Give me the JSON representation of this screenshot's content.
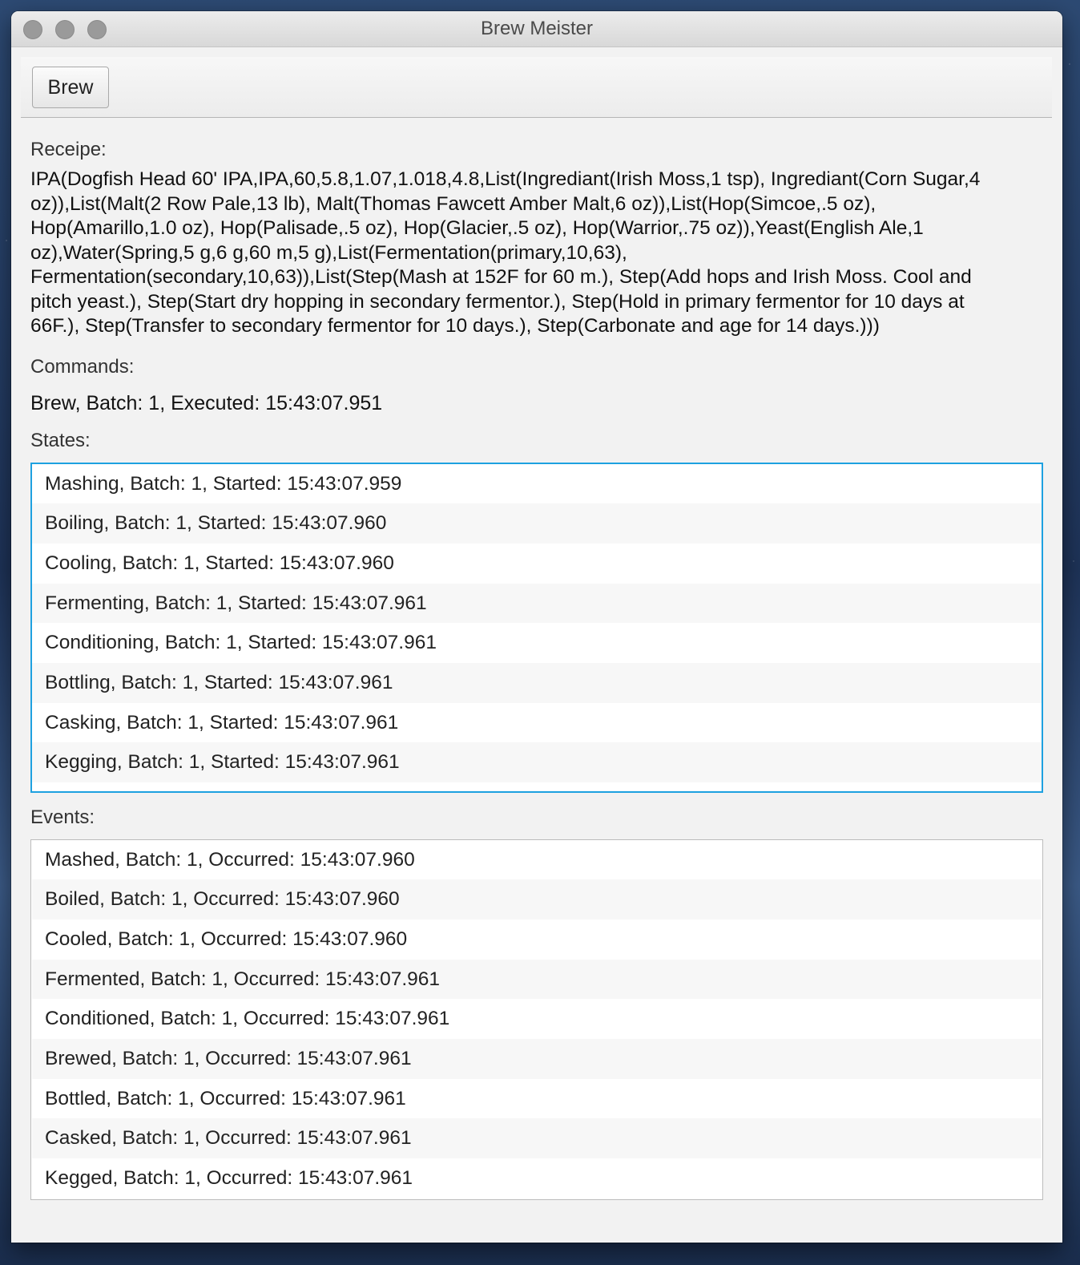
{
  "window": {
    "title": "Brew Meister"
  },
  "toolbar": {
    "brew_label": "Brew"
  },
  "recipe": {
    "label": "Receipe:",
    "text": "IPA(Dogfish Head 60' IPA,IPA,60,5.8,1.07,1.018,4.8,List(Ingrediant(Irish Moss,1 tsp), Ingrediant(Corn Sugar,4 oz)),List(Malt(2 Row Pale,13 lb), Malt(Thomas Fawcett Amber Malt,6 oz)),List(Hop(Simcoe,.5 oz), Hop(Amarillo,1.0 oz), Hop(Palisade,.5 oz), Hop(Glacier,.5 oz), Hop(Warrior,.75 oz)),Yeast(English Ale,1 oz),Water(Spring,5 g,6 g,60 m,5 g),List(Fermentation(primary,10,63), Fermentation(secondary,10,63)),List(Step(Mash at 152F for 60 m.), Step(Add hops and Irish Moss. Cool and pitch yeast.), Step(Start dry hopping in secondary fermentor.), Step(Hold in primary fermentor for 10 days at 66F.), Step(Transfer to secondary fermentor for 10 days.), Step(Carbonate and age for 14 days.)))"
  },
  "commands": {
    "label": "Commands:",
    "text": "Brew, Batch: 1, Executed: 15:43:07.951"
  },
  "states": {
    "label": "States:",
    "items": [
      "Mashing, Batch: 1, Started: 15:43:07.959",
      "Boiling, Batch: 1, Started: 15:43:07.960",
      "Cooling, Batch: 1, Started: 15:43:07.960",
      "Fermenting, Batch: 1, Started: 15:43:07.961",
      "Conditioning, Batch: 1, Started: 15:43:07.961",
      "Bottling, Batch: 1, Started: 15:43:07.961",
      "Casking, Batch: 1, Started: 15:43:07.961",
      "Kegging, Batch: 1, Started: 15:43:07.961"
    ]
  },
  "events": {
    "label": "Events:",
    "items": [
      "Mashed, Batch: 1, Occurred: 15:43:07.960",
      "Boiled, Batch: 1, Occurred: 15:43:07.960",
      "Cooled, Batch: 1, Occurred: 15:43:07.960",
      "Fermented, Batch: 1, Occurred: 15:43:07.961",
      "Conditioned, Batch: 1, Occurred: 15:43:07.961",
      "Brewed, Batch: 1, Occurred: 15:43:07.961",
      "Bottled, Batch: 1, Occurred: 15:43:07.961",
      "Casked, Batch: 1, Occurred: 15:43:07.961",
      "Kegged, Batch: 1, Occurred: 15:43:07.961"
    ]
  },
  "colors": {
    "focus_ring": "#1ea1e0",
    "window_bg": "#f2f2f2"
  }
}
